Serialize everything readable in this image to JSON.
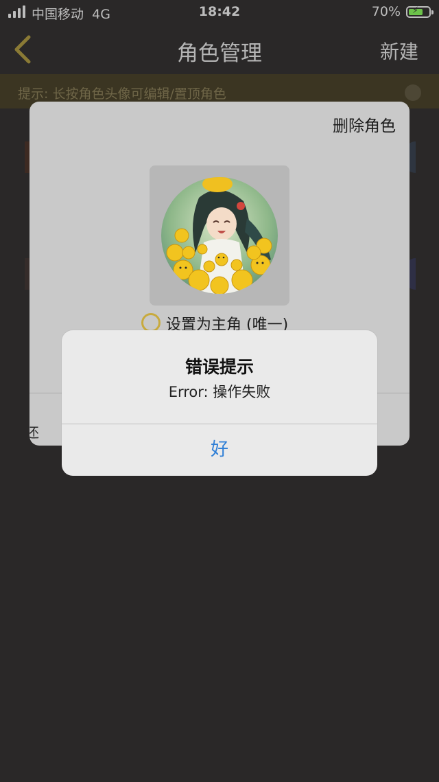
{
  "status_bar": {
    "carrier": "中国移动",
    "network": "4G",
    "time": "18:42",
    "battery_percent": "70%",
    "battery_level": 0.7,
    "battery_color": "#6cc24a"
  },
  "nav": {
    "back_icon": "chevron-left-icon",
    "title": "角色管理",
    "new_label": "新建"
  },
  "hint": {
    "text": "提示: 长按角色头像可编辑/置顶角色",
    "close_icon": "close-circle-icon"
  },
  "role_dialog": {
    "delete_label": "删除角色",
    "avatar_icon": "anime-girl-avatar-image",
    "set_main_label": "设置为主角 (唯一)",
    "bottom_text": "还"
  },
  "alert": {
    "title": "错误提示",
    "message": "Error: 操作失败",
    "ok_label": "好",
    "ok_color": "#2f7fd6"
  }
}
